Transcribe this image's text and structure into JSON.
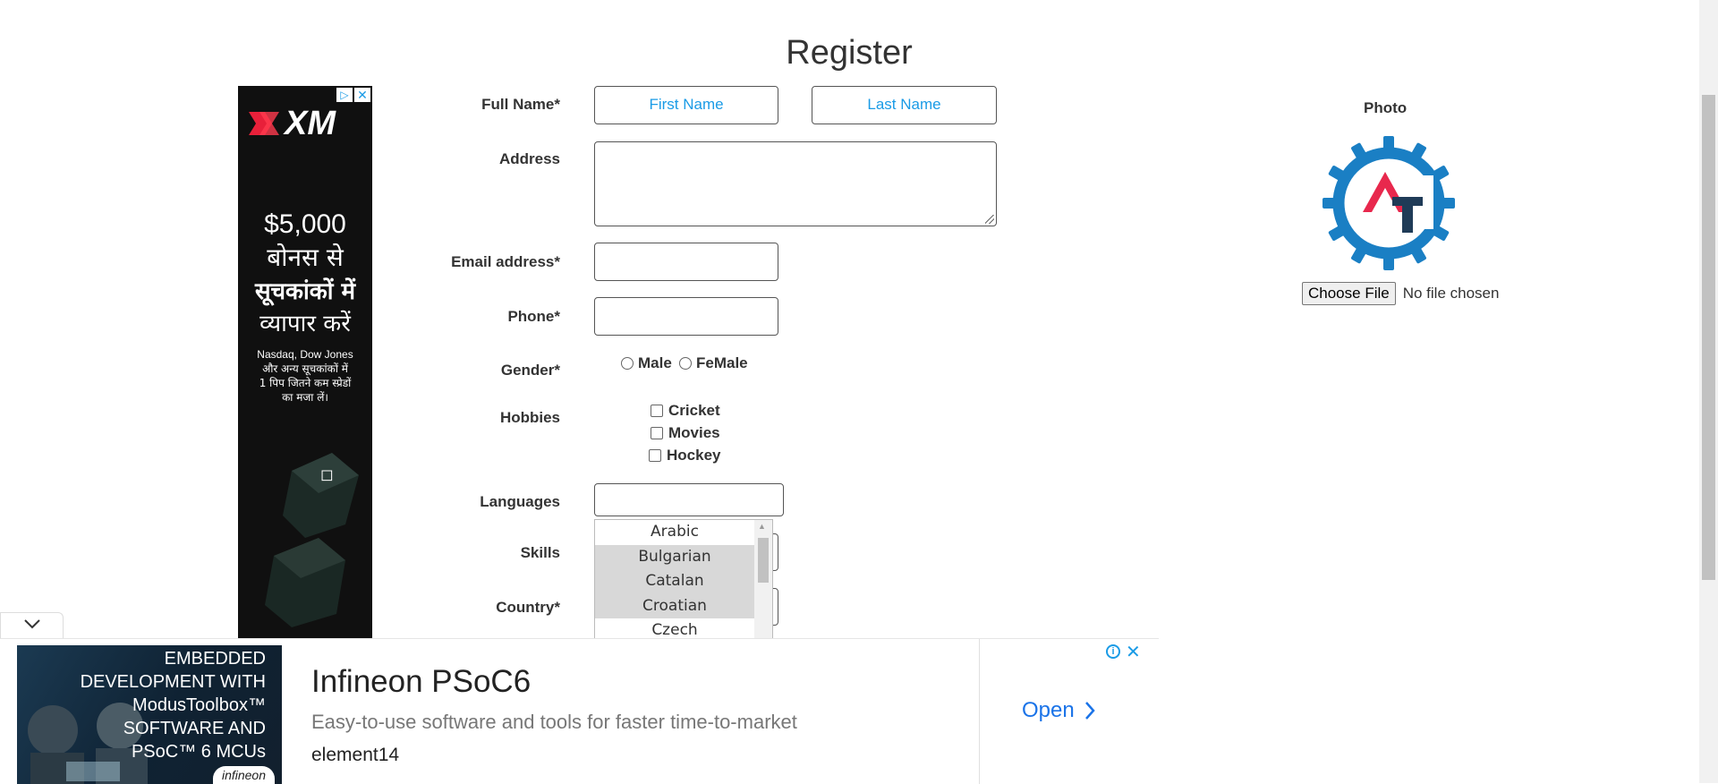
{
  "page": {
    "title": "Register"
  },
  "form": {
    "full_name_label": "Full Name*",
    "first_name_placeholder": "First Name",
    "last_name_placeholder": "Last Name",
    "address_label": "Address",
    "email_label": "Email address*",
    "phone_label": "Phone*",
    "gender_label": "Gender*",
    "gender_options": [
      "Male",
      "FeMale"
    ],
    "hobbies_label": "Hobbies",
    "hobbies": [
      "Cricket",
      "Movies",
      "Hockey"
    ],
    "languages_label": "Languages",
    "languages": [
      "Arabic",
      "Bulgarian",
      "Catalan",
      "Croatian",
      "Czech"
    ],
    "skills_label": "Skills",
    "country_label": "Country*"
  },
  "photo": {
    "label": "Photo",
    "choose_button": "Choose File",
    "status": "No file chosen",
    "logo_colors": {
      "gear": "#1a7fc4",
      "a": "#e8284d",
      "t": "#1f3b57"
    }
  },
  "side_ad": {
    "brand": "XM",
    "amount": "$5,000",
    "line1": "बोनस से",
    "line2": "सूचकांकों में",
    "line3": "व्यापार करें",
    "small1": "Nasdaq, Dow Jones",
    "small2": "और अन्य सूचकांकों में",
    "small3": "1 पिप जितने कम स्प्रेडों",
    "small4": "का मजा लें।"
  },
  "bottom_ad": {
    "image_lines": [
      "EMBEDDED",
      "DEVELOPMENT WITH",
      "ModusToolbox™",
      "SOFTWARE AND",
      "PSoC™ 6 MCUs"
    ],
    "image_brand": "infineon",
    "headline": "Infineon PSoC6",
    "subline": "Easy-to-use software and tools for faster time-to-market",
    "advertiser": "element14",
    "cta": "Open"
  }
}
